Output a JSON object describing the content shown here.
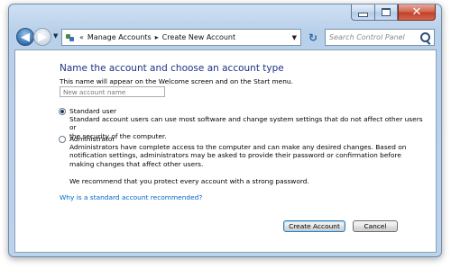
{
  "window": {
    "caption_buttons": {
      "minimize_icon": "minimize-icon",
      "maximize_icon": "maximize-icon",
      "close_icon": "close-icon",
      "close_color": "#c1412a"
    }
  },
  "toolbar": {
    "back_icon": "back-arrow-icon",
    "forward_icon": "forward-arrow-icon",
    "breadcrumb_prefix": "«",
    "breadcrumb": [
      "Manage Accounts",
      "Create New Account"
    ],
    "breadcrumb_separator": "▸",
    "refresh_icon": "refresh-icon",
    "search_placeholder": "Search Control Panel"
  },
  "main": {
    "heading": "Name the account and choose an account type",
    "subtext": "This name will appear on the Welcome screen and on the Start menu.",
    "name_placeholder": "New account name",
    "options": [
      {
        "label": "Standard user",
        "checked": true,
        "description": "Standard account users can use most software and change system settings that do not affect other users or\nthe security of the computer."
      },
      {
        "label": "Administrator",
        "checked": false,
        "description": "Administrators have complete access to the computer and can make any desired changes. Based on\nnotification settings, administrators may be asked to provide their password or confirmation before\nmaking changes that affect other users."
      }
    ],
    "recommendation": "We recommend that you protect every account with a strong password.",
    "help_link": "Why is a standard account recommended?",
    "create_button": "Create Account",
    "cancel_button": "Cancel",
    "heading_color": "#1e3287",
    "link_color": "#0066cc"
  }
}
